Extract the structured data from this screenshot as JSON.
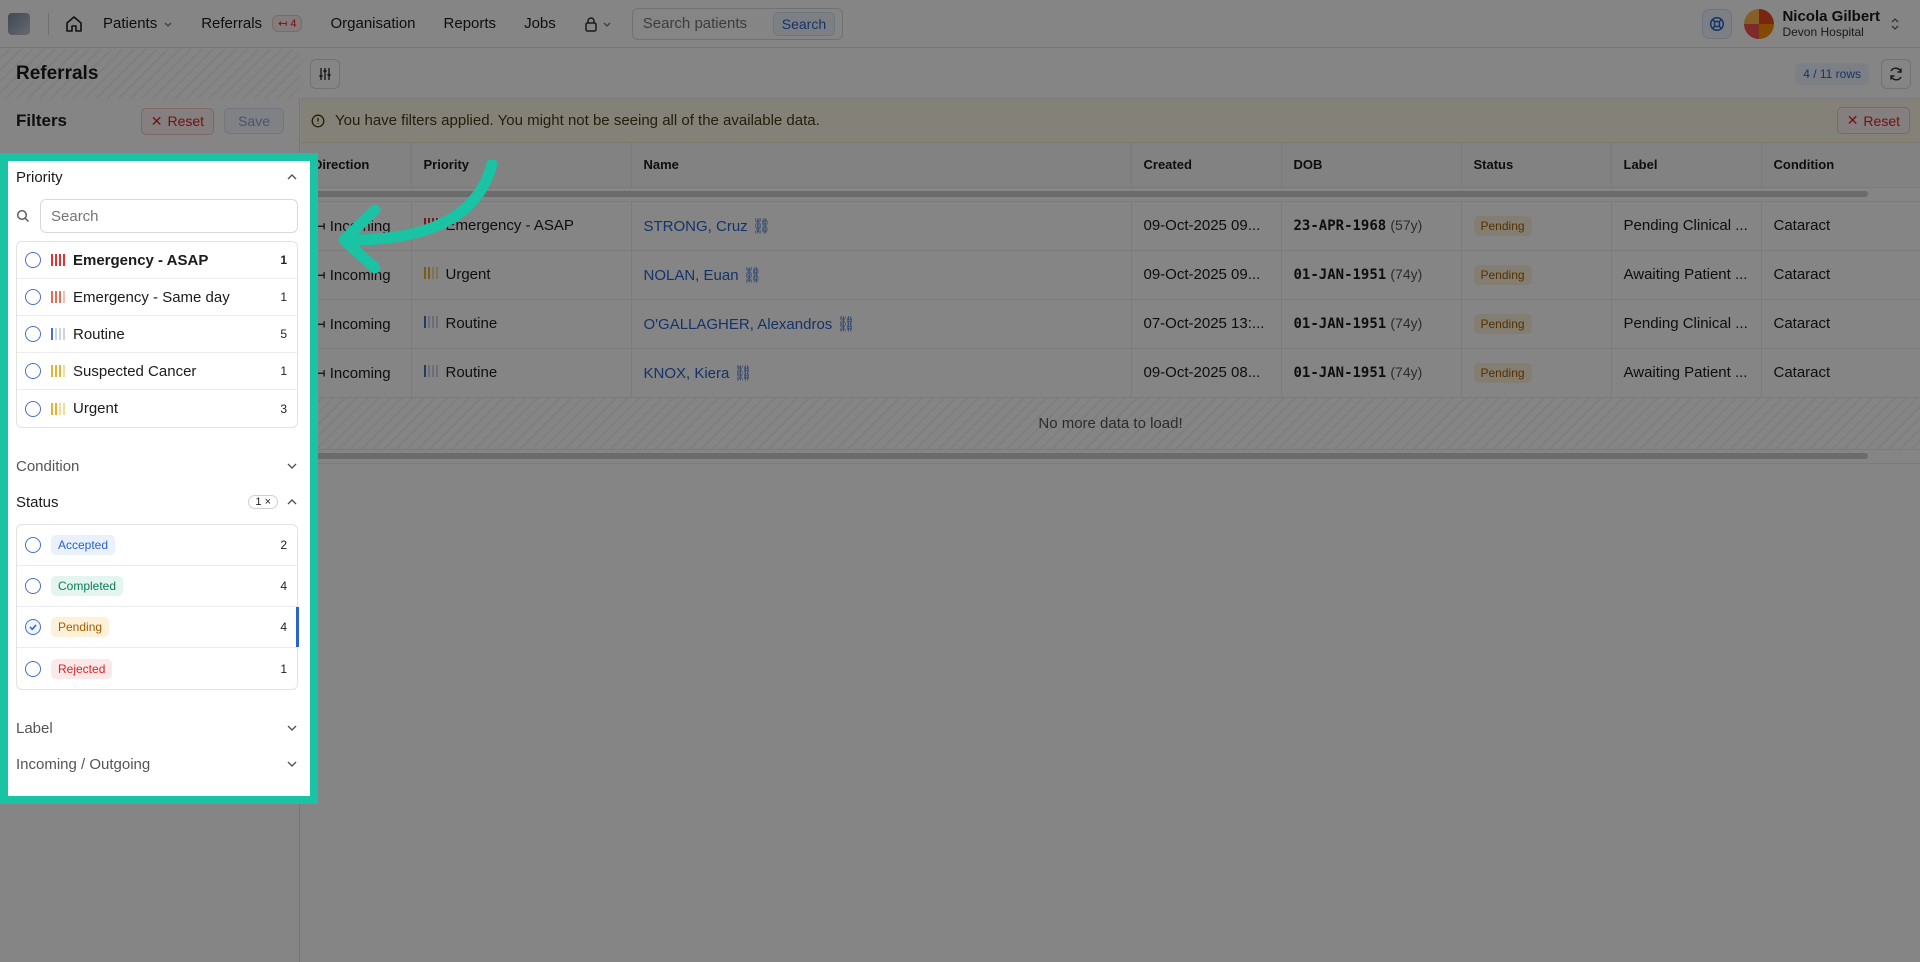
{
  "nav": {
    "items": [
      {
        "label": "Patients"
      },
      {
        "label": "Referrals",
        "badge": "4"
      },
      {
        "label": "Organisation"
      },
      {
        "label": "Reports"
      },
      {
        "label": "Jobs"
      }
    ],
    "search_placeholder": "Search patients",
    "search_button": "Search",
    "user": {
      "name": "Nicola Gilbert",
      "org": "Devon Hospital"
    }
  },
  "sidebar": {
    "title": "Referrals",
    "filters_title": "Filters",
    "reset_label": "Reset",
    "save_label": "Save",
    "priority": {
      "title": "Priority",
      "search_placeholder": "Search",
      "options": [
        {
          "label": "Emergency - ASAP",
          "count": "1"
        },
        {
          "label": "Emergency - Same day",
          "count": "1"
        },
        {
          "label": "Routine",
          "count": "5"
        },
        {
          "label": "Suspected Cancer",
          "count": "1"
        },
        {
          "label": "Urgent",
          "count": "3"
        }
      ]
    },
    "condition": {
      "title": "Condition"
    },
    "status": {
      "title": "Status",
      "active_count": "1",
      "options": [
        {
          "label": "Accepted",
          "count": "2"
        },
        {
          "label": "Completed",
          "count": "4"
        },
        {
          "label": "Pending",
          "count": "4",
          "selected": true
        },
        {
          "label": "Rejected",
          "count": "1"
        }
      ]
    },
    "label": {
      "title": "Label"
    },
    "incoming": {
      "title": "Incoming / Outgoing"
    }
  },
  "main": {
    "rows_chip": "4 / 11 rows",
    "alert_text": "You have filters applied. You might not be seeing all of the available data.",
    "alert_reset": "Reset",
    "columns": [
      "Direction",
      "Priority",
      "Name",
      "Created",
      "DOB",
      "Status",
      "Label",
      "Condition"
    ],
    "rows": [
      {
        "direction": "Incoming",
        "priority": "Emergency - ASAP",
        "name": "STRONG, Cruz",
        "created": "09-Oct-2025 09...",
        "dob": "23-APR-1968",
        "age": "(57y)",
        "status": "Pending",
        "label": "Pending Clinical ...",
        "condition": "Cataract"
      },
      {
        "direction": "Incoming",
        "priority": "Urgent",
        "name": "NOLAN, Euan",
        "created": "09-Oct-2025 09...",
        "dob": "01-JAN-1951",
        "age": "(74y)",
        "status": "Pending",
        "label": "Awaiting Patient ...",
        "condition": "Cataract"
      },
      {
        "direction": "Incoming",
        "priority": "Routine",
        "name": "O'GALLAGHER, Alexandros",
        "created": "07-Oct-2025 13:...",
        "dob": "01-JAN-1951",
        "age": "(74y)",
        "status": "Pending",
        "label": "Pending Clinical ...",
        "condition": "Cataract"
      },
      {
        "direction": "Incoming",
        "priority": "Routine",
        "name": "KNOX, Kiera",
        "created": "09-Oct-2025 08...",
        "dob": "01-JAN-1951",
        "age": "(74y)",
        "status": "Pending",
        "label": "Awaiting Patient ...",
        "condition": "Cataract"
      }
    ],
    "no_more": "No more data to load!"
  },
  "colors": {
    "highlight": "#19c3a3",
    "accent": "#2a63c9",
    "danger": "#dd2222"
  }
}
